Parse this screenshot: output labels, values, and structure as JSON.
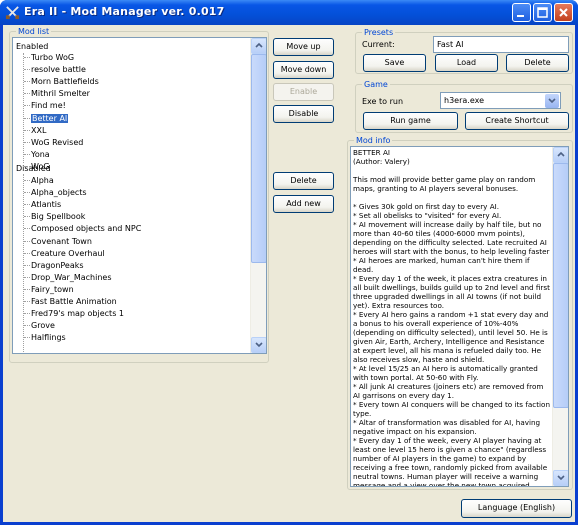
{
  "window": {
    "title": "Era II - Mod Manager ver. 0.017"
  },
  "mod_list": {
    "group_title": "Mod list",
    "enabled_label": "Enabled",
    "enabled_items": [
      "Turbo WoG",
      "resolve battle",
      "Morn Battlefields",
      "Mithril Smelter",
      "Find me!",
      "Better AI",
      "XXL",
      "WoG Revised",
      "Yona",
      "WoG"
    ],
    "selected_item": "Better AI",
    "disabled_label": "Disabled",
    "disabled_items": [
      "Alpha",
      "Alpha_objects",
      "Atlantis",
      "Big Spellbook",
      "Composed objects and NPC",
      "Covenant Town",
      "Creature Overhaul",
      "DragonPeaks",
      "Drop_War_Machines",
      "Fairy_town",
      "Fast Battle Animation",
      "Fred79's map objects 1",
      "Grove",
      "Halflings"
    ]
  },
  "buttons": {
    "move_up": "Move up",
    "move_down": "Move down",
    "enable": "Enable",
    "disable": "Disable",
    "delete": "Delete",
    "add_new": "Add new"
  },
  "presets": {
    "group_title": "Presets",
    "current_label": "Current:",
    "current_value": "Fast AI",
    "save": "Save",
    "load": "Load",
    "delete": "Delete"
  },
  "game": {
    "group_title": "Game",
    "exe_label": "Exe to run",
    "exe_value": "h3era.exe",
    "run_game": "Run game",
    "create_shortcut": "Create Shortcut"
  },
  "mod_info": {
    "group_title": "Mod info",
    "text": "BETTER AI\n(Author: Valery)\n\nThis mod will provide better game play on random maps, granting to AI players several bonuses.\n\n* Gives 30k gold on first day to every AI.\n* Set all obelisks to \"visited\" for every AI.\n* AI movement will increase daily by half tile, but no more than 40-60 tiles (4000-6000 mvm points), depending on the difficulty selected. Late recruited AI heroes will start with the bonus, to help leveling faster\n* AI heroes are marked, human can't hire them if dead.\n* Every day 1 of the week, it places extra creatures in all built dwellings, builds guild up to 2nd level and first three upgraded dwellings in all AI towns (if not build yet). Extra resources too.\n* Every AI hero gains a random +1 stat every day and a bonus to his overall experience of 10%-40% (depending on difficulty selected), until level 50. He is given Air, Earth, Archery, Intelligence and Resistance at expert level, all his mana is refueled daily too. He also receives slow, haste and shield.\n* At level 15/25 an AI hero is automatically granted with town portal. At 50-60 with Fly.\n* All junk AI creatures (joiners etc) are removed from AI garrisons on every day 1.\n* Every town AI conquers will be changed to its faction type.\n* Altar of transformation was disabled for AI, having negative impact on his expansion.\n* Every day 1 of the week, every AI player having at least one level 15 hero is given a chance\" (regardless number of AI players in the game) to expand by receiving a free town, randomly picked from available neutral towns. Human player will receive a warning message and a view over the new town acquired."
  },
  "language_button": "Language (English)"
}
